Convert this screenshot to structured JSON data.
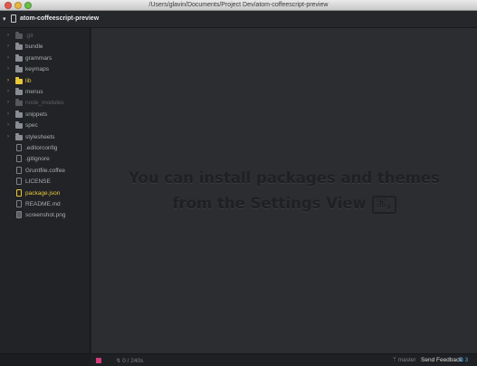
{
  "window": {
    "title": "/Users/glavin/Documents/Project Dev/atom-coffeescript-preview"
  },
  "tree": {
    "root_name": "atom-coffeescript-preview",
    "items": [
      {
        "label": ".git",
        "kind": "folder",
        "state": "dim"
      },
      {
        "label": "bundle",
        "kind": "folder",
        "state": "normal"
      },
      {
        "label": "grammars",
        "kind": "folder",
        "state": "normal"
      },
      {
        "label": "keymaps",
        "kind": "folder",
        "state": "normal"
      },
      {
        "label": "lib",
        "kind": "folder",
        "state": "highlight"
      },
      {
        "label": "menus",
        "kind": "folder",
        "state": "normal"
      },
      {
        "label": "node_modules",
        "kind": "folder",
        "state": "dim"
      },
      {
        "label": "snippets",
        "kind": "folder",
        "state": "normal"
      },
      {
        "label": "spec",
        "kind": "folder",
        "state": "normal"
      },
      {
        "label": "stylesheets",
        "kind": "folder",
        "state": "normal"
      },
      {
        "label": ".editorconfig",
        "kind": "file",
        "state": "normal"
      },
      {
        "label": ".gitignore",
        "kind": "file",
        "state": "normal"
      },
      {
        "label": "Gruntfile.coffee",
        "kind": "file",
        "state": "normal"
      },
      {
        "label": "LICENSE",
        "kind": "file",
        "state": "normal"
      },
      {
        "label": "package.json",
        "kind": "file",
        "state": "highlight"
      },
      {
        "label": "README.md",
        "kind": "file",
        "state": "normal"
      },
      {
        "label": "screenshot.png",
        "kind": "image",
        "state": "normal"
      }
    ]
  },
  "welcome": {
    "line1": "You can install packages and themes",
    "line2": "from the Settings View",
    "shortcut": "⌘,"
  },
  "status": {
    "cursor": "0 / 240s",
    "branch": "master",
    "feedback": "Send Feedback",
    "updates": "3"
  },
  "colors": {
    "highlight": "#e8c83a",
    "accent": "#4fa7d8",
    "status_square": "#d23a7a"
  }
}
